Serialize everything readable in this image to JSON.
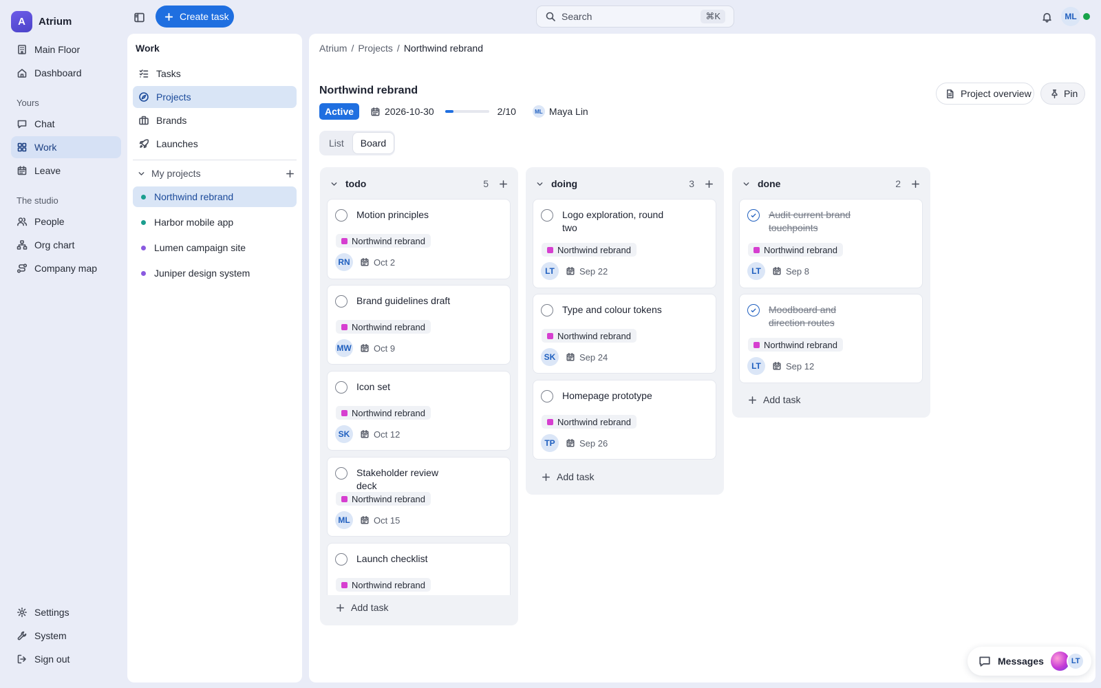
{
  "app": {
    "name": "Atrium",
    "logo_letter": "A"
  },
  "topbar": {
    "create_label": "Create task",
    "search_placeholder": "Search",
    "search_shortcut": "⌘K",
    "user_initials": "ML",
    "online_color": "#17a34a"
  },
  "leftnav": {
    "top_items": [
      {
        "label": "Main Floor",
        "icon": "building-icon"
      },
      {
        "label": "Dashboard",
        "icon": "home-icon"
      }
    ],
    "yours_label": "Yours",
    "yours_items": [
      {
        "label": "Chat",
        "icon": "chat-icon"
      },
      {
        "label": "Work",
        "icon": "grid-icon",
        "active": true
      },
      {
        "label": "Leave",
        "icon": "calendar-icon"
      }
    ],
    "studio_label": "The studio",
    "studio_items": [
      {
        "label": "People",
        "icon": "people-icon"
      },
      {
        "label": "Org chart",
        "icon": "org-chart-icon"
      },
      {
        "label": "Company map",
        "icon": "route-icon"
      }
    ],
    "bottom_items": [
      {
        "label": "Settings",
        "icon": "gear-icon"
      },
      {
        "label": "System",
        "icon": "wrench-icon"
      },
      {
        "label": "Sign out",
        "icon": "sign-out-icon"
      }
    ]
  },
  "work_panel": {
    "title": "Work",
    "items": [
      {
        "label": "Tasks",
        "icon": "tasks-icon"
      },
      {
        "label": "Projects",
        "icon": "compass-icon",
        "active": true
      },
      {
        "label": "Brands",
        "icon": "briefcase-icon"
      },
      {
        "label": "Launches",
        "icon": "rocket-icon"
      }
    ],
    "my_projects_label": "My projects",
    "projects": [
      {
        "label": "Northwind rebrand",
        "color": "#1b9e8f",
        "active": true
      },
      {
        "label": "Harbor mobile app",
        "color": "#1b9e8f"
      },
      {
        "label": "Lumen campaign site",
        "color": "#8a5ae0"
      },
      {
        "label": "Juniper design system",
        "color": "#8a5ae0"
      }
    ]
  },
  "main": {
    "breadcrumb": [
      "Atrium",
      "Projects",
      "Northwind rebrand"
    ],
    "title": "Northwind rebrand",
    "status": "Active",
    "due_date": "2026-10-30",
    "progress_text": "2/10",
    "progress_fraction": 0.2,
    "owner_initials": "ML",
    "owner_name": "Maya Lin",
    "overview_label": "Project overview",
    "pin_label": "Pin",
    "view_options": [
      "List",
      "Board"
    ],
    "active_view": "Board",
    "accent": "#1f6fe0",
    "tag_color": "#d63fd0"
  },
  "board": {
    "add_task_label": "Add task",
    "columns": [
      {
        "name": "todo",
        "count": "5",
        "cards": [
          {
            "title": "Motion principles",
            "tag": "Northwind rebrand",
            "assignee": "RN",
            "due": "Oct 2"
          },
          {
            "title": "Brand guidelines draft",
            "tag": "Northwind rebrand",
            "assignee": "MW",
            "due": "Oct 9"
          },
          {
            "title": "Icon set",
            "tag": "Northwind rebrand",
            "assignee": "SK",
            "due": "Oct 12"
          },
          {
            "title": "Stakeholder review deck",
            "tag": "Northwind rebrand",
            "assignee": "ML",
            "due": "Oct 15"
          },
          {
            "title": "Launch checklist",
            "tag": "Northwind rebrand",
            "assignee": "",
            "due": ""
          }
        ]
      },
      {
        "name": "doing",
        "count": "3",
        "cards": [
          {
            "title": "Logo exploration, round two",
            "tag": "Northwind rebrand",
            "assignee": "LT",
            "due": "Sep 22"
          },
          {
            "title": "Type and colour tokens",
            "tag": "Northwind rebrand",
            "assignee": "SK",
            "due": "Sep 24"
          },
          {
            "title": "Homepage prototype",
            "tag": "Northwind rebrand",
            "assignee": "TP",
            "due": "Sep 26"
          }
        ]
      },
      {
        "name": "done",
        "count": "2",
        "cards": [
          {
            "title": "Audit current brand touchpoints",
            "tag": "Northwind rebrand",
            "assignee": "LT",
            "due": "Sep 8",
            "done": true
          },
          {
            "title": "Moodboard and direction routes",
            "tag": "Northwind rebrand",
            "assignee": "LT",
            "due": "Sep 12",
            "done": true
          }
        ]
      }
    ]
  },
  "messages": {
    "label": "Messages",
    "avatar_initials": "LT"
  }
}
